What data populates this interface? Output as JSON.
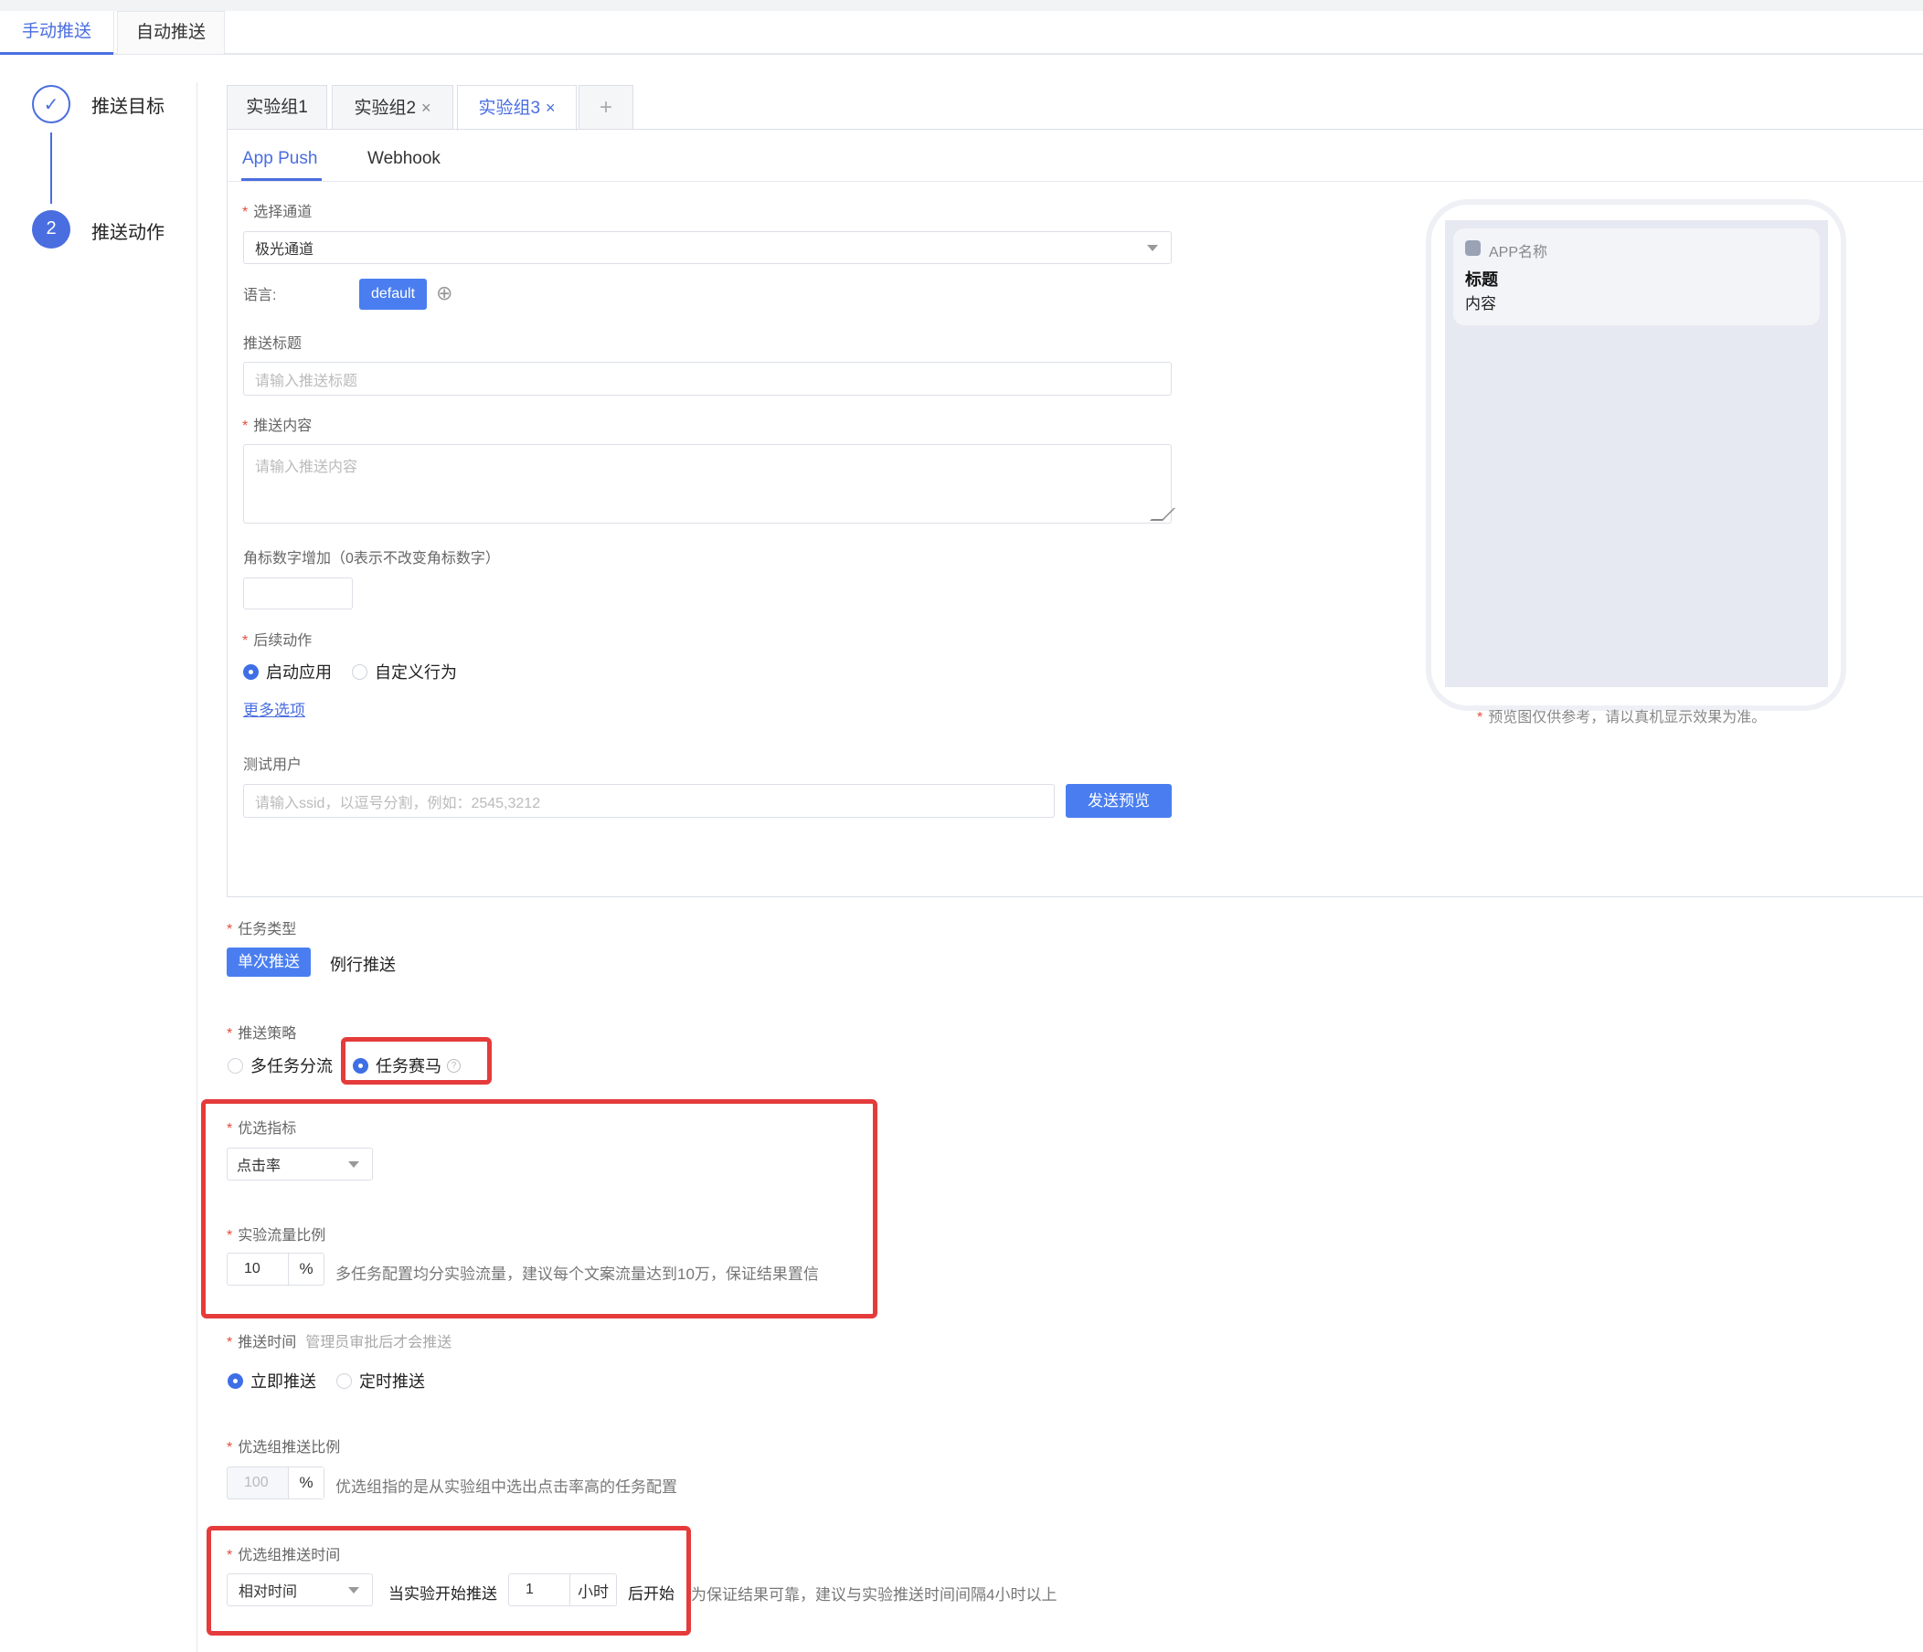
{
  "main_tabs": [
    "手动推送",
    "自动推送"
  ],
  "steps": [
    {
      "index": "✓",
      "label": "推送目标"
    },
    {
      "index": "2",
      "label": "推送动作"
    }
  ],
  "group_tabs": {
    "g1": "实验组1",
    "g2": "实验组2",
    "g3": "实验组3",
    "add": "+",
    "close": "×"
  },
  "sub_tabs": [
    "App Push",
    "Webhook"
  ],
  "form": {
    "channel_label": "选择通道",
    "channel_value": "极光通道",
    "language_label": "语言:",
    "language_value": "default",
    "add_icon": "⊕",
    "title_label": "推送标题",
    "title_placeholder": "请输入推送标题",
    "content_label": "推送内容",
    "content_placeholder": "请输入推送内容",
    "badge_label": "角标数字增加（0表示不改变角标数字）",
    "action_label": "后续动作",
    "action_options": [
      "启动应用",
      "自定义行为"
    ],
    "more_options": "更多选项",
    "test_user_label": "测试用户",
    "test_user_placeholder": "请输入ssid，以逗号分割，例如：2545,3212",
    "send_preview": "发送预览"
  },
  "preview": {
    "app_name": "APP名称",
    "title": "标题",
    "content": "内容",
    "note": "预览图仅供参考，请以真机显示效果为准。"
  },
  "task": {
    "type_label": "任务类型",
    "type_options": [
      "单次推送",
      "例行推送"
    ],
    "strategy_label": "推送策略",
    "strategy_options": [
      "多任务分流",
      "任务赛马"
    ],
    "help_icon": "?",
    "metric_label": "优选指标",
    "metric_value": "点击率",
    "traffic_label": "实验流量比例",
    "traffic_value": "10",
    "percent": "%",
    "traffic_help": "多任务配置均分实验流量，建议每个文案流量达到10万，保证结果置信",
    "time_label": "推送时间",
    "time_hint": "管理员审批后才会推送",
    "time_options": [
      "立即推送",
      "定时推送"
    ],
    "preferred_ratio_label": "优选组推送比例",
    "preferred_ratio_value": "100",
    "preferred_ratio_help": "优选组指的是从实验组中选出点击率高的任务配置",
    "preferred_time_label": "优选组推送时间",
    "preferred_time_mode": "相对时间",
    "preferred_time_prefix": "当实验开始推送",
    "preferred_time_value": "1",
    "preferred_time_unit": "小时",
    "preferred_time_suffix": "后开始",
    "preferred_time_help": "为保证结果可靠，建议与实验推送时间间隔4小时以上"
  },
  "required_mark": "*",
  "colors": {
    "accent": "#4a6ee0",
    "highlight": "#e53b3b",
    "required": "#e74c3c"
  }
}
